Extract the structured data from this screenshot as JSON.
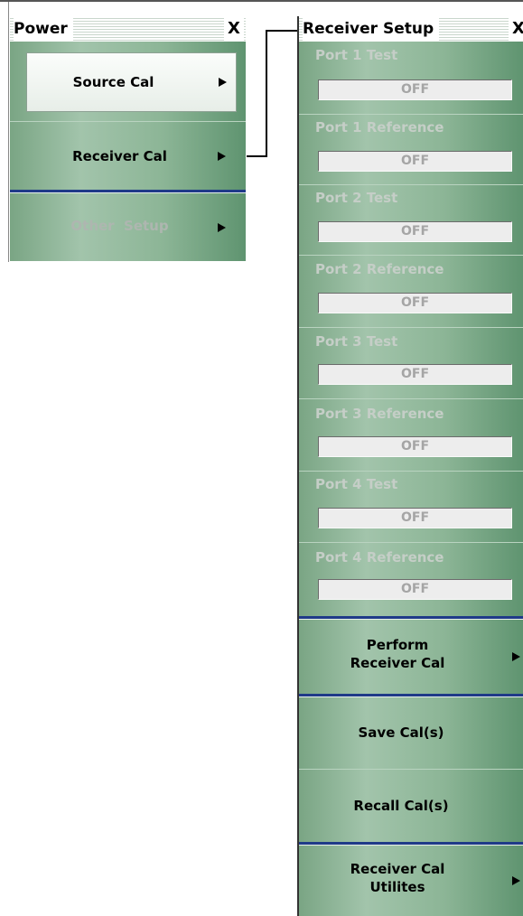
{
  "power_menu": {
    "title": "Power",
    "close": "X",
    "items": [
      {
        "label": "Source Cal",
        "enabled": true,
        "submenu": true
      },
      {
        "label": "Receiver Cal",
        "enabled": true,
        "submenu": true
      },
      {
        "label": "Other  Setup",
        "enabled": false,
        "submenu": true
      }
    ]
  },
  "receiver_setup": {
    "title": "Receiver Setup",
    "close": "X",
    "fields": [
      {
        "label": "Port 1 Test",
        "value": "OFF"
      },
      {
        "label": "Port 1 Reference",
        "value": "OFF"
      },
      {
        "label": "Port 2 Test",
        "value": "OFF"
      },
      {
        "label": "Port 2 Reference",
        "value": "OFF"
      },
      {
        "label": "Port 3 Test",
        "value": "OFF"
      },
      {
        "label": "Port 3 Reference",
        "value": "OFF"
      },
      {
        "label": "Port 4 Test",
        "value": "OFF"
      },
      {
        "label": "Port 4 Reference",
        "value": "OFF"
      }
    ],
    "buttons": [
      {
        "label_line1": "Perform",
        "label_line2": "Receiver Cal",
        "submenu": true
      },
      {
        "label": "Save Cal(s)",
        "submenu": false
      },
      {
        "label": "Recall Cal(s)",
        "submenu": false
      },
      {
        "label_line1": "Receiver Cal",
        "label_line2": "Utilites",
        "submenu": true
      }
    ]
  },
  "colors": {
    "panel_green": "#8cb596",
    "separator_blue": "#1f3a88",
    "disabled_text": "#aeb6b0"
  }
}
